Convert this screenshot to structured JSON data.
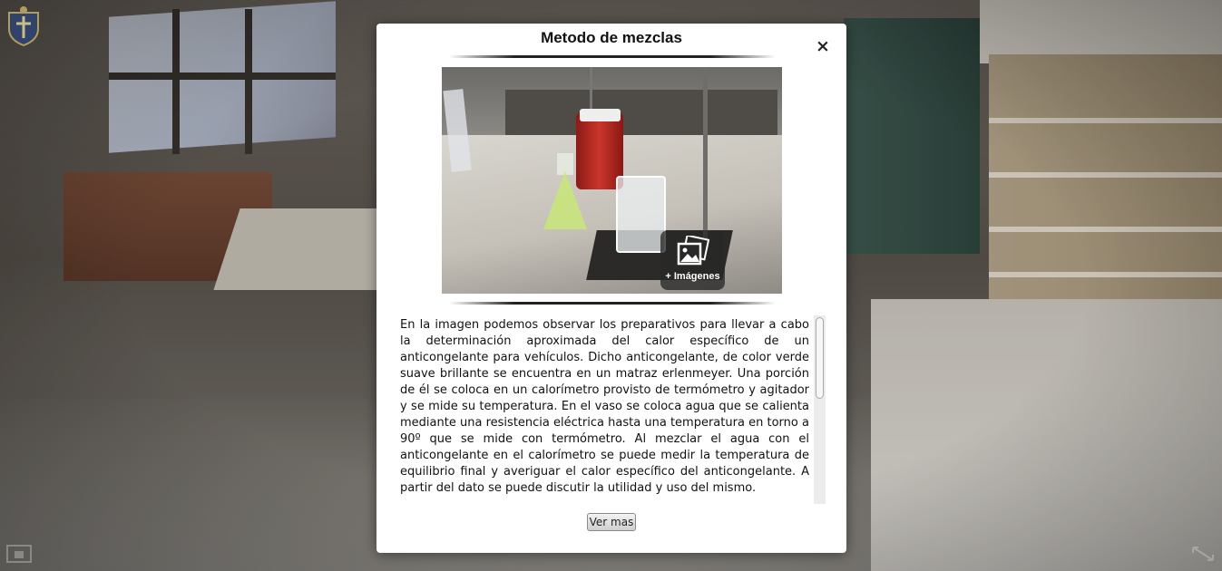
{
  "modal": {
    "title": "Metodo de mezclas",
    "close_label": "×",
    "more_images_label": "+ Imágenes",
    "description": "En la imagen podemos observar los preparativos para llevar a cabo la determinación aproximada del calor específico de un anticongelante para vehículos. Dicho anticongelante, de color verde suave brillante se encuentra en un matraz erlenmeyer. Una porción de él se coloca en un calorímetro provisto de termómetro y agitador y se mide su temperatura. En el vaso se coloca agua que se calienta mediante una resistencia eléctrica hasta una temperatura en torno a 90º que se mide con termómetro. Al mezclar el agua con el anticongelante en el calorímetro se puede medir la temperatura de equilibrio final y averiguar el calor específico del anticongelante. A partir del dato se puede discutir la utilidad y uso del mismo.",
    "more_button_label": "Ver mas"
  },
  "icons": {
    "logo": "crest-logo-icon",
    "close": "close-icon",
    "gallery": "image-gallery-icon",
    "left_corner": "info-panel-icon",
    "right_corner": "fullscreen-icon"
  },
  "colors": {
    "modal_background": "#ffffff",
    "badge_background": "#282828",
    "text": "#111111"
  }
}
